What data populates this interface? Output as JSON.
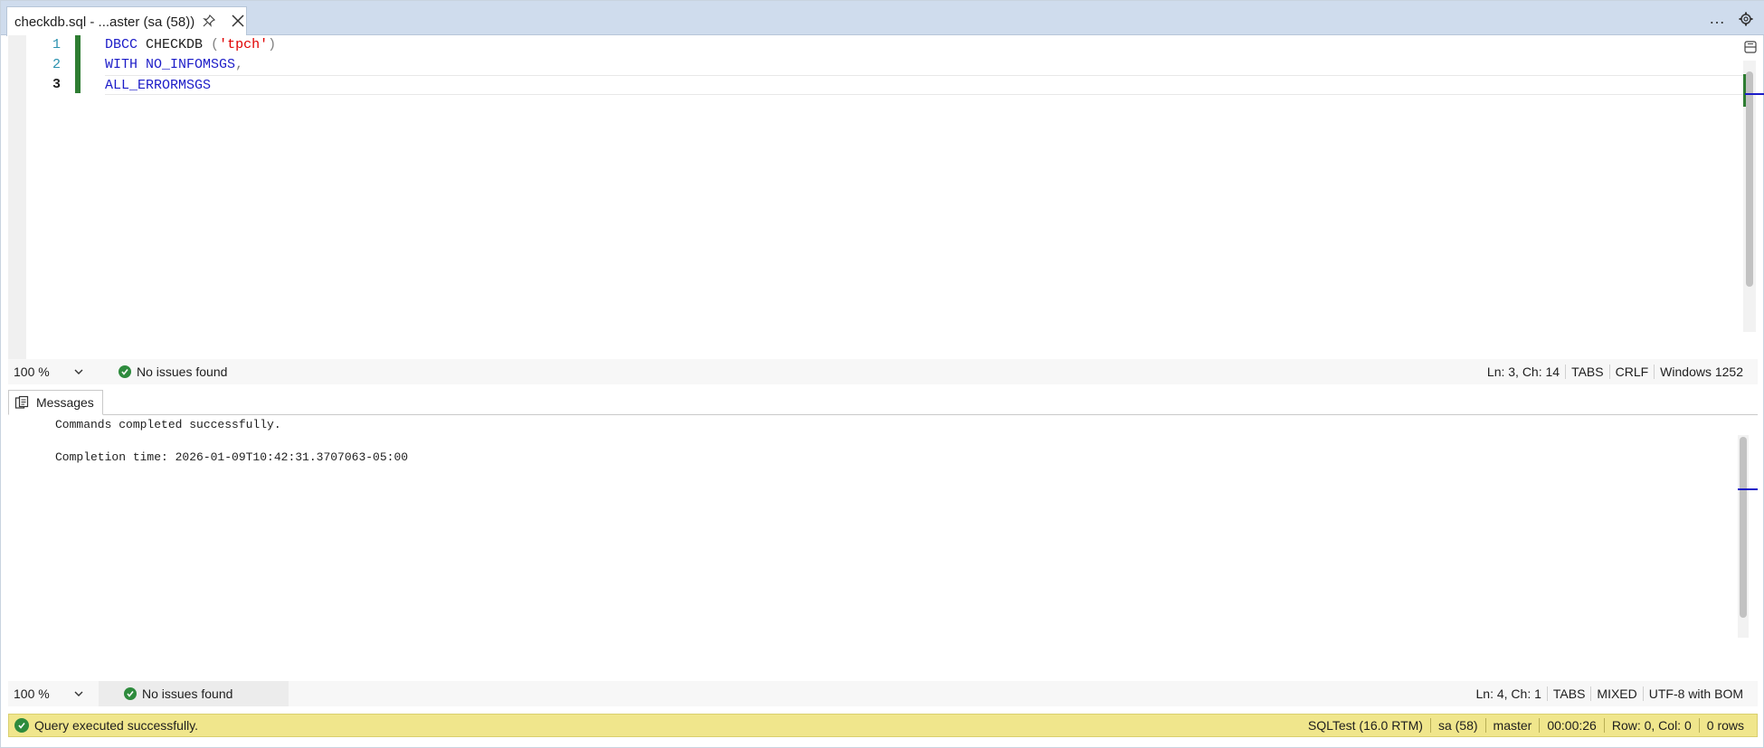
{
  "tab": {
    "title": "checkdb.sql - ...aster (sa (58))",
    "pin_icon": "pin-icon",
    "close_icon": "close-icon",
    "overflow": "…"
  },
  "editor": {
    "line_numbers": [
      "1",
      "2",
      "3"
    ],
    "lines": [
      [
        {
          "t": "DBCC",
          "c": "kw"
        },
        {
          "t": " ",
          "c": "plain"
        },
        {
          "t": "CHECKDB",
          "c": "plain"
        },
        {
          "t": " (",
          "c": "op"
        },
        {
          "t": "'tpch'",
          "c": "str"
        },
        {
          "t": ")",
          "c": "op"
        }
      ],
      [
        {
          "t": "WITH",
          "c": "kw"
        },
        {
          "t": " ",
          "c": "plain"
        },
        {
          "t": "NO_INFOMSGS",
          "c": "kw"
        },
        {
          "t": ",",
          "c": "op"
        }
      ],
      [
        {
          "t": "ALL_ERRORMSGS",
          "c": "kw"
        }
      ]
    ],
    "current_line": 3
  },
  "editor_status": {
    "zoom": "100 %",
    "issues": "No issues found",
    "position": "Ln: 3, Ch: 14",
    "indent": "TABS",
    "line_ending": "CRLF",
    "encoding": "Windows 1252"
  },
  "results": {
    "tab_label": "Messages",
    "messages": [
      "Commands completed successfully.",
      "Completion time: 2026-01-09T10:42:31.3707063-05:00"
    ]
  },
  "results_status": {
    "zoom": "100 %",
    "issues": "No issues found",
    "position": "Ln: 4, Ch: 1",
    "indent": "TABS",
    "line_ending": "MIXED",
    "encoding": "UTF-8 with BOM"
  },
  "query_status": {
    "message": "Query executed successfully.",
    "server": "SQLTest (16.0 RTM)",
    "user": "sa (58)",
    "database": "master",
    "elapsed": "00:00:26",
    "cursor": "Row: 0, Col: 0",
    "rows": "0 rows"
  },
  "colors": {
    "keyword": "#1c1cc8",
    "string": "#e00000",
    "line_number": "#2b91af",
    "change_bar": "#2e7d32",
    "status_bar": "#f0e68c",
    "tab_bar": "#cfdced"
  }
}
